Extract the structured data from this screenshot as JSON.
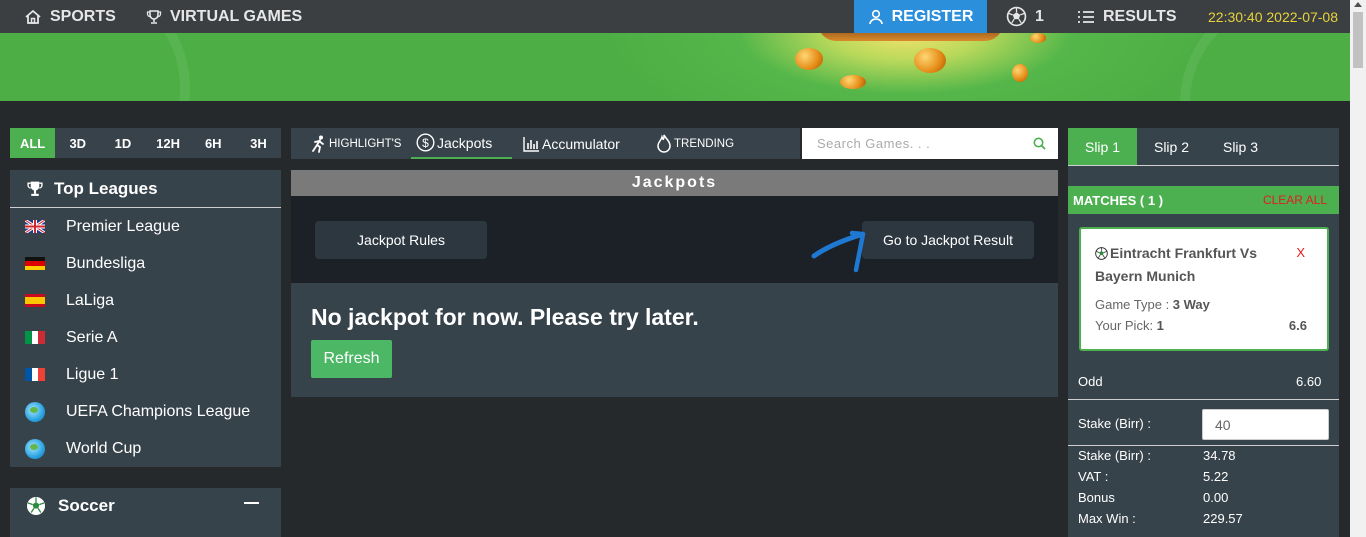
{
  "topnav": {
    "sports": "SPORTS",
    "virtual_games": "VIRTUAL GAMES",
    "register": "REGISTER",
    "bet_count": "1",
    "results": "RESULTS",
    "datetime": "22:30:40 2022-07-08"
  },
  "time_filters": [
    "ALL",
    "3D",
    "1D",
    "12H",
    "6H",
    "3H"
  ],
  "top_leagues": {
    "title": "Top Leagues",
    "items": [
      {
        "label": "Premier League",
        "icon": "uk-flag-icon"
      },
      {
        "label": "Bundesliga",
        "icon": "germany-flag-icon"
      },
      {
        "label": "LaLiga",
        "icon": "spain-flag-icon"
      },
      {
        "label": "Serie A",
        "icon": "italy-flag-icon"
      },
      {
        "label": "Ligue 1",
        "icon": "france-flag-icon"
      },
      {
        "label": "UEFA Champions League",
        "icon": "globe-icon"
      },
      {
        "label": "World Cup",
        "icon": "globe-icon"
      }
    ]
  },
  "soccer": {
    "title": "Soccer"
  },
  "tabs": {
    "highlights": "HIGHLIGHT'S",
    "jackpots": "Jackpots",
    "accumulator": "Accumulator",
    "trending": "TRENDING"
  },
  "search": {
    "placeholder": "Search Games. . ."
  },
  "jackpot": {
    "title": "Jackpots",
    "rules_button": "Jackpot Rules",
    "result_button": "Go to Jackpot Result",
    "empty_message": "No jackpot for now. Please try later.",
    "refresh_button": "Refresh"
  },
  "slip": {
    "tabs": [
      "Slip 1",
      "Slip 2",
      "Slip 3"
    ],
    "matches_label": "MATCHES ( 1 )",
    "clear_all": "CLEAR ALL",
    "match": {
      "name": "Eintracht Frankfurt Vs Bayern Munich",
      "remove": "X",
      "game_type_label": "Game Type : ",
      "game_type": "3 Way",
      "pick_label": "Your Pick: ",
      "pick": "1",
      "odd": "6.6"
    },
    "odd_label": "Odd",
    "odd_value": "6.60",
    "stake_label": "Stake (Birr) :",
    "stake_input": "40",
    "summary": [
      {
        "label": "Stake (Birr) :",
        "value": "34.78"
      },
      {
        "label": "VAT :",
        "value": "5.22"
      },
      {
        "label": "Bonus",
        "value": "0.00"
      },
      {
        "label": "Max Win :",
        "value": "229.57"
      }
    ]
  },
  "colors": {
    "accent_green": "#4caf50",
    "register_blue": "#2b8fdc",
    "clock_yellow": "#e8d23a",
    "clear_red": "#e0201e"
  }
}
